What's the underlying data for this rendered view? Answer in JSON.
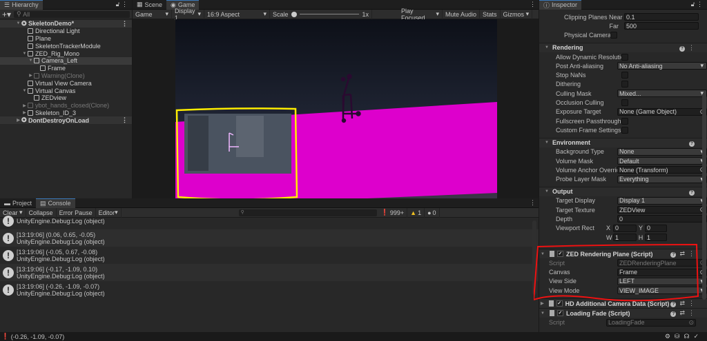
{
  "hierarchy": {
    "tab": "Hierarchy",
    "search_placeholder": "All",
    "items": [
      {
        "label": "SkeletonDemo*",
        "type": "scene"
      },
      {
        "label": "Directional Light"
      },
      {
        "label": "Plane"
      },
      {
        "label": "SkeletonTrackerModule"
      },
      {
        "label": "ZED_Rig_Mono"
      },
      {
        "label": "Camera_Left"
      },
      {
        "label": "Frame"
      },
      {
        "label": "Warning(Clone)"
      },
      {
        "label": "Virtual View Camera"
      },
      {
        "label": "Virtual Canvas"
      },
      {
        "label": "ZEDview"
      },
      {
        "label": "ybot_hands_closed(Clone)"
      },
      {
        "label": "Skeleton_ID_3"
      },
      {
        "label": "DontDestroyOnLoad",
        "type": "scene"
      }
    ]
  },
  "game": {
    "tabs": [
      "Scene",
      "Game"
    ],
    "mode": "Game",
    "display": "Display 1",
    "aspect": "16:9 Aspect",
    "scale_label": "Scale",
    "scale_value": "1x",
    "play_focused": "Play Focused",
    "mute_audio": "Mute Audio",
    "stats": "Stats",
    "gizmos": "Gizmos",
    "colors": {
      "plane": "#dd00cc",
      "annotation": "#ffee00"
    }
  },
  "console": {
    "tabs": [
      "Project",
      "Console"
    ],
    "toolbar": {
      "clear": "Clear",
      "collapse": "Collapse",
      "error_pause": "Error Pause",
      "editor": "Editor"
    },
    "counts": {
      "log": "999+",
      "warning": "1",
      "error": "0"
    },
    "entries": [
      {
        "line1": "",
        "line2": "UnityEngine.Debug:Log (object)"
      },
      {
        "line1": "[13:19:06] (0.06, 0.65, -0.05)",
        "line2": "UnityEngine.Debug:Log (object)"
      },
      {
        "line1": "[13:19:06] (-0.05, 0.67, -0.08)",
        "line2": "UnityEngine.Debug:Log (object)"
      },
      {
        "line1": "[13:19:06] (-0.17, -1.09, 0.10)",
        "line2": "UnityEngine.Debug:Log (object)"
      },
      {
        "line1": "[13:19:06] (-0.26, -1.09, -0.07)",
        "line2": "UnityEngine.Debug:Log (object)"
      }
    ]
  },
  "status": {
    "message": "(-0.26, -1.09, -0.07)"
  },
  "inspector": {
    "tab": "Inspector",
    "camera": {
      "clip_near_label": "Clipping Planes Near",
      "clip_near": "0.1",
      "far_label": "Far",
      "far": "500",
      "physical_label": "Physical Camera"
    },
    "rendering": {
      "title": "Rendering",
      "rows": [
        {
          "label": "Allow Dynamic Resolution",
          "kind": "check"
        },
        {
          "label": "Post Anti-aliasing",
          "kind": "dropdown",
          "value": "No Anti-aliasing"
        },
        {
          "label": "Stop NaNs",
          "kind": "check"
        },
        {
          "label": "Dithering",
          "kind": "check"
        },
        {
          "label": "Culling Mask",
          "kind": "dropdown",
          "value": "Mixed..."
        },
        {
          "label": "Occlusion Culling",
          "kind": "check"
        },
        {
          "label": "Exposure Target",
          "kind": "object",
          "value": "None (Game Object)"
        },
        {
          "label": "Fullscreen Passthrough",
          "kind": "check"
        },
        {
          "label": "Custom Frame Settings",
          "kind": "check"
        }
      ]
    },
    "environment": {
      "title": "Environment",
      "rows": [
        {
          "label": "Background Type",
          "kind": "dropdown",
          "value": "None"
        },
        {
          "label": "Volume Mask",
          "kind": "dropdown",
          "value": "Default"
        },
        {
          "label": "Volume Anchor Override",
          "kind": "object",
          "value": "None (Transform)"
        },
        {
          "label": "Probe Layer Mask",
          "kind": "dropdown",
          "value": "Everything"
        }
      ]
    },
    "output": {
      "title": "Output",
      "rows": [
        {
          "label": "Target Display",
          "kind": "dropdown",
          "value": "Display 1"
        },
        {
          "label": "Target Texture",
          "kind": "object",
          "value": "ZEDView"
        },
        {
          "label": "Depth",
          "kind": "text",
          "value": "0"
        }
      ],
      "viewport_label": "Viewport Rect",
      "x": "0",
      "y": "0",
      "w": "1",
      "h": "1"
    },
    "zed_plane": {
      "title": "ZED Rendering Plane (Script)",
      "rows": [
        {
          "label": "Script",
          "kind": "object",
          "value": "ZEDRenderingPlane",
          "dim": true
        },
        {
          "label": "Canvas",
          "kind": "object",
          "value": "Frame"
        },
        {
          "label": "View Side",
          "kind": "dropdown",
          "value": "LEFT"
        },
        {
          "label": "View Mode",
          "kind": "dropdown",
          "value": "VIEW_IMAGE"
        }
      ]
    },
    "hd_data": {
      "title": "HD Additional Camera Data (Script)"
    },
    "loading_fade": {
      "title": "Loading Fade (Script)",
      "script_label": "Script",
      "script": "LoadingFade"
    },
    "annotation_color": "#ee1111"
  }
}
